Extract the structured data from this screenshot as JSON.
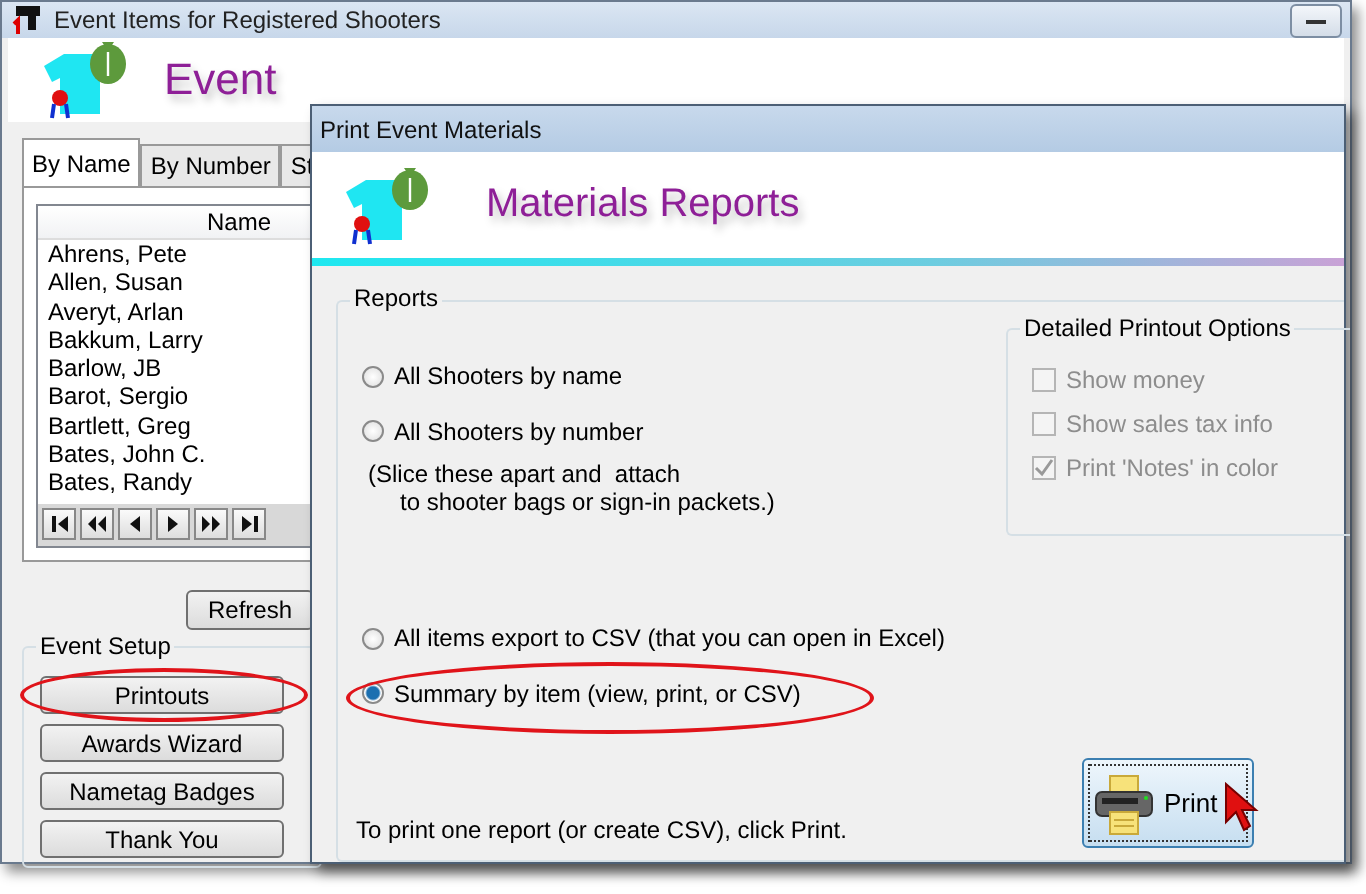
{
  "window": {
    "title": "Event Items for Registered Shooters"
  },
  "header": {
    "title": "Event"
  },
  "tabs": [
    {
      "label": "By Name",
      "selected": true
    },
    {
      "label": "By Number",
      "selected": false
    },
    {
      "label": "St",
      "selected": false
    }
  ],
  "name_list": {
    "column": "Name",
    "rows": [
      "Ahrens, Pete",
      "Allen, Susan",
      "Averyt, Arlan",
      "Bakkum, Larry",
      "Barlow, JB",
      "Barot, Sergio",
      "Bartlett, Greg",
      "Bates, John C.",
      "Bates, Randy"
    ]
  },
  "refresh_button": "Refresh",
  "event_setup": {
    "title": "Event Setup",
    "buttons": [
      {
        "label": "Printouts",
        "highlighted": true
      },
      {
        "label": "Awards Wizard",
        "highlighted": false
      },
      {
        "label": "Nametag Badges",
        "highlighted": false
      },
      {
        "label": "Thank You",
        "highlighted": false
      }
    ]
  },
  "dialog": {
    "title": "Print Event Materials",
    "header": "Materials Reports",
    "reports": {
      "title": "Reports",
      "options": [
        {
          "label": "All Shooters by name",
          "selected": false,
          "highlighted": false
        },
        {
          "label": "All Shooters by number",
          "selected": false,
          "highlighted": false,
          "note": [
            "(Slice these apart and  attach",
            "to shooter bags or sign-in packets.)"
          ]
        },
        {
          "label": "All items export to CSV (that you can open in Excel)",
          "selected": false,
          "highlighted": false
        },
        {
          "label": "Summary by item (view, print, or CSV)",
          "selected": true,
          "highlighted": true
        }
      ]
    },
    "detailed_options": {
      "title": "Detailed Printout Options",
      "items": [
        {
          "label": "Show money",
          "checked": false,
          "disabled": true
        },
        {
          "label": "Show sales tax info",
          "checked": false,
          "disabled": true
        },
        {
          "label": "Print 'Notes' in color",
          "checked": true,
          "disabled": true
        }
      ]
    },
    "footer_text": "To print one report (or create CSV), click Print.",
    "print_button": "Print"
  }
}
